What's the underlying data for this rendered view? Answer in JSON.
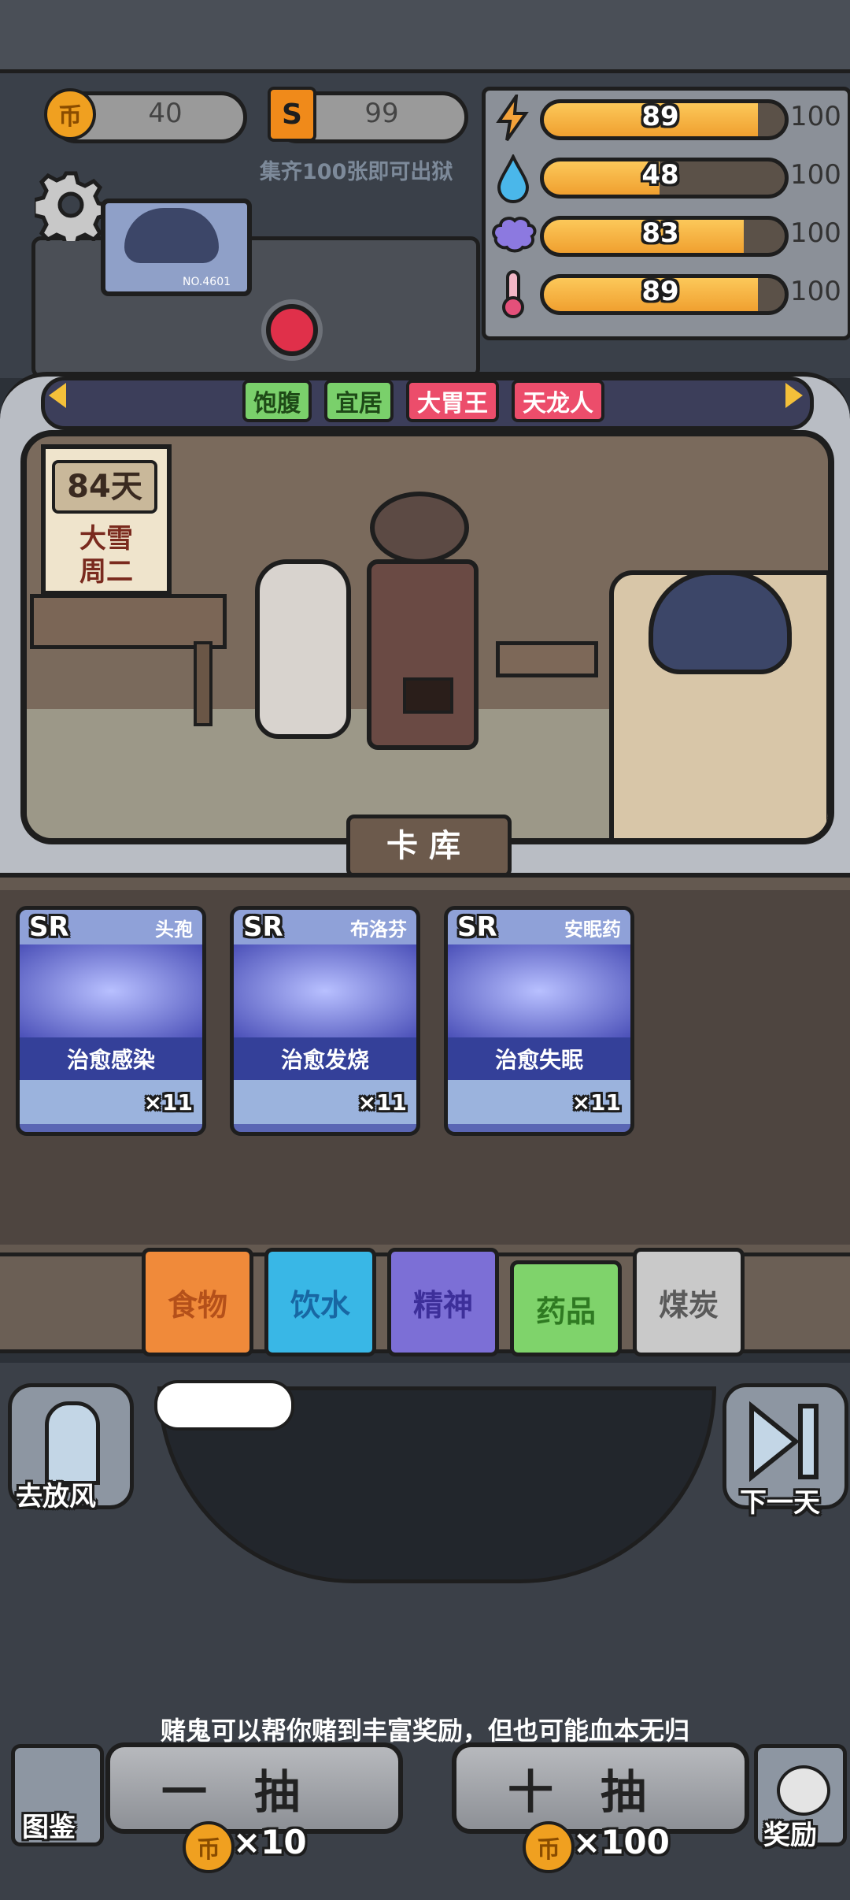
{
  "currency": {
    "coins": "40",
    "tickets": "99",
    "collect_hint": "集齐100张即可出狱"
  },
  "portrait": {
    "number": "NO.4601"
  },
  "stats": [
    {
      "icon": "lightning-icon",
      "value": "89",
      "max": "100",
      "fill": 0.89
    },
    {
      "icon": "water-drop-icon",
      "value": "48",
      "max": "100",
      "fill": 0.48
    },
    {
      "icon": "brain-icon",
      "value": "83",
      "max": "100",
      "fill": 0.83
    },
    {
      "icon": "thermometer-icon",
      "value": "89",
      "max": "100",
      "fill": 0.89
    }
  ],
  "tags": [
    "饱腹",
    "宜居",
    "大胃王",
    "天龙人"
  ],
  "calendar": {
    "days": "84天",
    "weather": "大雪",
    "weekday": "周二"
  },
  "card_library_label": "卡库",
  "cards": [
    {
      "rarity": "SR",
      "name": "头孢",
      "effect": "治愈感染",
      "count": "×11"
    },
    {
      "rarity": "SR",
      "name": "布洛芬",
      "effect": "治愈发烧",
      "count": "×11"
    },
    {
      "rarity": "SR",
      "name": "安眠药",
      "effect": "治愈失眠",
      "count": "×11"
    }
  ],
  "categories": [
    {
      "label": "食物",
      "color": "#f08a3a",
      "text_color": "#b4501a"
    },
    {
      "label": "饮水",
      "color": "#39b7e6",
      "text_color": "#1867a3"
    },
    {
      "label": "精神",
      "color": "#7c6fd6",
      "text_color": "#3d2f9a"
    },
    {
      "label": "药品",
      "color": "#7fd36b",
      "text_color": "#2f7a22"
    },
    {
      "label": "煤炭",
      "color": "#c9c9c9",
      "text_color": "#5a5a5a"
    }
  ],
  "side_buttons": {
    "yard": "去放风",
    "next_day": "下一天"
  },
  "gamble_hint": "赌鬼可以帮你赌到丰富奖励，但也可能血本无归",
  "draw": {
    "one_label": "一抽",
    "one_cost": "×10",
    "ten_label": "十抽",
    "ten_cost": "×100"
  },
  "bottom": {
    "codex": "图鉴",
    "reward": "奖励"
  },
  "coin_glyph": "币",
  "ticket_glyph": "S"
}
